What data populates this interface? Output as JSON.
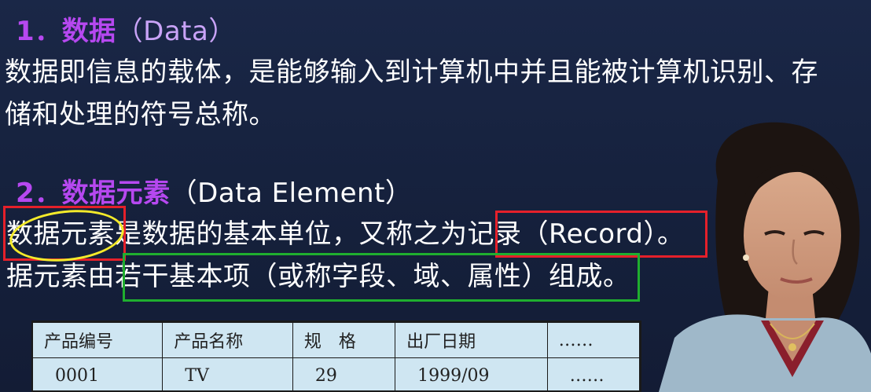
{
  "section1": {
    "number": "1．",
    "title": "数据",
    "title_en": "（Data）",
    "body_line1": "数据即信息的载体，是能够输入到计算机中并且能被计算机识别、存",
    "body_line2": "储和处理的符号总称。"
  },
  "section2": {
    "number": "2．",
    "title": "数据元素",
    "title_en": "（Data Element）",
    "body_line1_a": "数据元素",
    "body_line1_b": "是数据的基本单位，又称之为",
    "body_line1_c": "记录（Record）",
    "body_line1_d": "。",
    "body_line2_a": "据元素由",
    "body_line2_b": "若干基本项（或称字段、域、属性）组成",
    "body_line2_c": "。"
  },
  "table": {
    "headers": [
      "产品编号",
      "产品名称",
      "规　格",
      "出厂日期",
      "……"
    ],
    "rows": [
      [
        "0001",
        "TV",
        "29",
        "1999/09",
        "……"
      ]
    ]
  },
  "colors": {
    "background": "#14213e",
    "heading_purple": "#b648f0",
    "heading_en": "#c9a3f7",
    "highlight_red": "#e5202a",
    "highlight_green": "#1fae2f",
    "annotation_yellow": "#f4ea2a",
    "table_fill": "#cfe6f2"
  }
}
